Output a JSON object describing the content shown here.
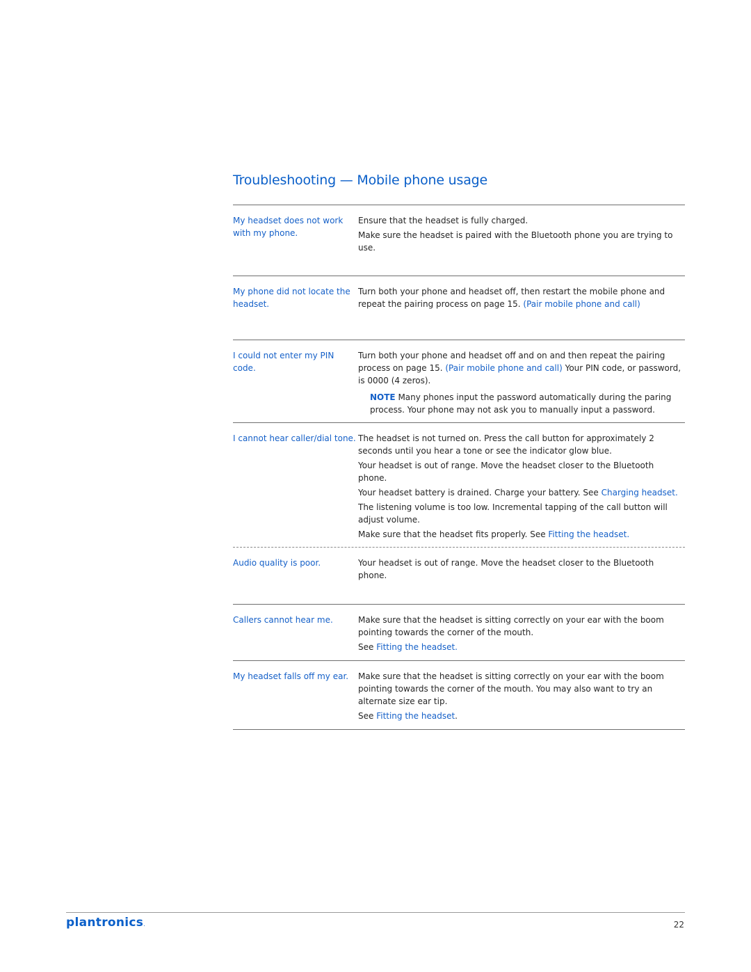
{
  "page": {
    "title": "Troubleshooting — Mobile phone usage",
    "page_number": "22"
  },
  "brand": {
    "logo_text": "plantronics",
    "logo_dot": ".",
    "accent_color": "#0a5fc9"
  },
  "rows": [
    {
      "problem": "My headset does not work with my phone.",
      "solutions": [
        {
          "text": "Ensure that the headset is fully charged."
        },
        {
          "text": "Make sure the headset is paired with the Bluetooth phone you are trying to use."
        }
      ]
    },
    {
      "problem": "My phone did not locate the headset.",
      "solutions": [
        {
          "text": "Turn both your phone and headset off, then restart the mobile phone and repeat the pairing process on page 15. ",
          "link": "(Pair mobile phone and call)"
        }
      ]
    },
    {
      "problem": "I could not enter my PIN code.",
      "solutions": [
        {
          "text": "Turn both your phone and headset off and on and then repeat the pairing process on page 15. ",
          "link": "(Pair mobile phone and call)",
          "after": " Your PIN code, or password, is 0000 (4 zeros)."
        }
      ],
      "note": {
        "label": "NOTE",
        "text": " Many phones input the password automatically during the paring process. Your phone may not ask you to manually input a password."
      }
    },
    {
      "problem": "I cannot hear caller/dial tone.",
      "solutions": [
        {
          "text": "The headset is not turned on. Press the call button for approximately 2 seconds until you hear a tone or see the indicator glow blue."
        },
        {
          "text": "Your headset is out of range. Move the headset closer to the Bluetooth phone."
        },
        {
          "text": "Your headset battery is drained. Charge your battery. See ",
          "link": "Charging headset."
        },
        {
          "text": "The listening volume is too low. Incremental tapping of the call button will adjust volume."
        },
        {
          "text": "Make sure that the headset fits properly. See ",
          "link": "Fitting the headset."
        }
      ]
    },
    {
      "problem": "Audio quality is poor.",
      "solutions": [
        {
          "text": "Your headset is out of range. Move the headset closer to the Bluetooth phone."
        }
      ]
    },
    {
      "problem": "Callers cannot hear me.",
      "solutions": [
        {
          "text": "Make sure that the headset is sitting correctly on your ear with the boom pointing towards the corner of the mouth."
        },
        {
          "text": "See ",
          "link": "Fitting the headset."
        }
      ]
    },
    {
      "problem": "My headset falls off my ear.",
      "solutions": [
        {
          "text": "Make sure that the headset is sitting correctly on your ear with the boom pointing towards the corner of the mouth. You may also want to try an alternate size ear tip."
        },
        {
          "text": "See ",
          "link": "Fitting the headset",
          "after": "."
        }
      ]
    }
  ]
}
